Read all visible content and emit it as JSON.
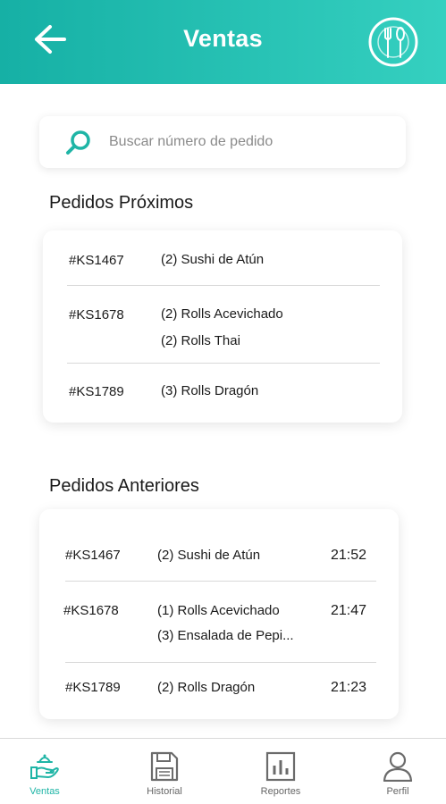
{
  "header": {
    "title": "Ventas",
    "back_icon": "arrow-left-icon",
    "logo_icon": "fork-spoon-plate-icon",
    "gradient": [
      "#16b0a5",
      "#35d0c0"
    ]
  },
  "search": {
    "placeholder": "Buscar número de pedido",
    "value": "",
    "icon": "search-icon",
    "accent": "#1fb5a6"
  },
  "upcoming": {
    "title": "Pedidos Próximos",
    "orders": [
      {
        "id": "#KS1467",
        "items": [
          "(2) Sushi de Atún"
        ]
      },
      {
        "id": "#KS1678",
        "items": [
          "(2) Rolls Acevichado",
          "(2) Rolls Thai"
        ]
      },
      {
        "id": "#KS1789",
        "items": [
          "(3) Rolls Dragón"
        ]
      }
    ]
  },
  "past": {
    "title": "Pedidos Anteriores",
    "orders": [
      {
        "id": "#KS1467",
        "items": [
          "(2) Sushi de Atún"
        ],
        "time": "21:52"
      },
      {
        "id": "#KS1678",
        "items": [
          "(1) Rolls Acevichado",
          "(3) Ensalada de Pepi..."
        ],
        "time": "21:47"
      },
      {
        "id": "#KS1789",
        "items": [
          "(2) Rolls Dragón"
        ],
        "time": "21:23"
      }
    ]
  },
  "nav": {
    "items": [
      {
        "label": "Ventas",
        "icon": "hand-serving-icon",
        "active": true
      },
      {
        "label": "Historial",
        "icon": "floppy-disk-icon",
        "active": false
      },
      {
        "label": "Reportes",
        "icon": "bar-chart-icon",
        "active": false
      },
      {
        "label": "Perfil",
        "icon": "user-icon",
        "active": false
      }
    ],
    "active_color": "#1fb5a6",
    "inactive_color": "#6b6b6b"
  }
}
